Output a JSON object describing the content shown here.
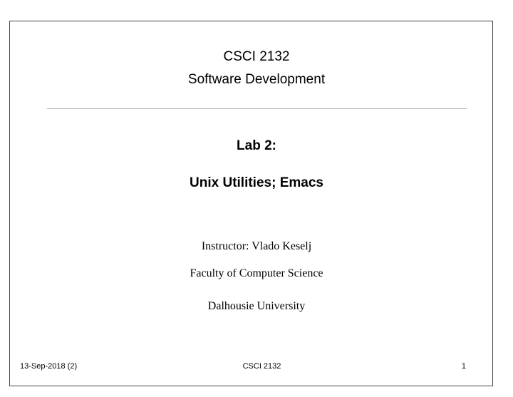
{
  "slide": {
    "course_code": "CSCI 2132",
    "course_name": "Software Development",
    "lab_number": "Lab 2:",
    "lab_topic": "Unix Utilities; Emacs",
    "instructor": "Instructor: Vlado Keselj",
    "faculty": "Faculty of Computer Science",
    "university": "Dalhousie University"
  },
  "footer": {
    "date": "13-Sep-2018 (2)",
    "course": "CSCI 2132",
    "page": "1"
  }
}
